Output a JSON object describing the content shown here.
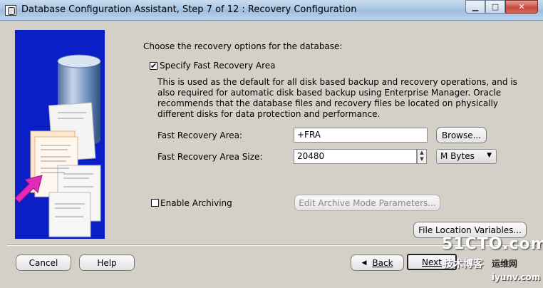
{
  "window": {
    "title": "Database Configuration Assistant, Step 7 of 12 : Recovery Configuration",
    "controls": {
      "minimize": "▁",
      "maximize": "□",
      "close": "✕"
    }
  },
  "content": {
    "prompt": "Choose the recovery options for the database:",
    "fast_recovery": {
      "checkbox_label": "Specify Fast Recovery Area",
      "checked": true,
      "checkmark": "✔",
      "description": "This is used as the default for all disk based backup and recovery operations, and is also required for automatic disk based backup using Enterprise Manager. Oracle recommends that the database files and recovery files be located on physically different disks for data protection and performance.",
      "area_label": "Fast Recovery Area:",
      "area_value": "+FRA",
      "browse_button": "Browse...",
      "size_label": "Fast Recovery Area Size:",
      "size_value": "20480",
      "unit_value": "M Bytes"
    },
    "archiving": {
      "checkbox_label": "Enable Archiving",
      "checked": false,
      "params_button": "Edit Archive Mode Parameters..."
    },
    "file_location_button": "File Location Variables..."
  },
  "footer": {
    "cancel": "Cancel",
    "help": "Help",
    "back": "Back",
    "next": "Next"
  },
  "watermark": {
    "site": "51CTO.com",
    "tagline": "技术博客",
    "brand": "运维网",
    "domain": "iyunv.com"
  },
  "colors": {
    "dialog_bg": "#d4d0c8",
    "art_bg": "#0a1fc6",
    "arrow": "#e02ab8",
    "title_bar": "#aac6e4"
  }
}
